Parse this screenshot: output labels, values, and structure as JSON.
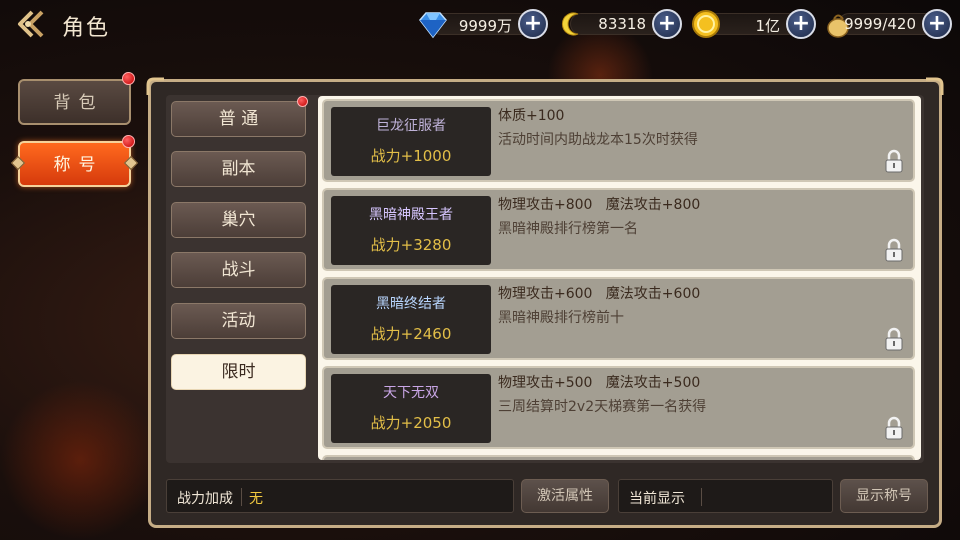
{
  "header": {
    "title": "角色",
    "currencies": [
      {
        "icon": "diamond-gem-icon",
        "value": "9999万"
      },
      {
        "icon": "moon-crescent-icon",
        "value": "83318"
      },
      {
        "icon": "gold-coin-icon",
        "value": "1亿"
      },
      {
        "icon": "stamina-pouch-icon",
        "value": "9999/420"
      }
    ]
  },
  "side_tabs": {
    "bag_label": "背包",
    "title_label": "称号"
  },
  "categories": [
    {
      "label": "普 通"
    },
    {
      "label": "副本"
    },
    {
      "label": "巢穴"
    },
    {
      "label": "战斗"
    },
    {
      "label": "活动"
    },
    {
      "label": "限时"
    }
  ],
  "titles": [
    {
      "name": "巨龙征服者",
      "name_color": "#bfb2d8",
      "power": "战力+1000",
      "attributes": "体质+100",
      "condition": "活动时间内助战龙本15次时获得"
    },
    {
      "name": "黑暗神殿王者",
      "name_color": "#d7c6ff",
      "power": "战力+3280",
      "attributes": "物理攻击+800   魔法攻击+800",
      "condition": "黑暗神殿排行榜第一名"
    },
    {
      "name": "黑暗终结者",
      "name_color": "#b9d7ff",
      "power": "战力+2460",
      "attributes": "物理攻击+600   魔法攻击+600",
      "condition": "黑暗神殿排行榜前十"
    },
    {
      "name": "天下无双",
      "name_color": "#c9a6e6",
      "power": "战力+2050",
      "attributes": "物理攻击+500   魔法攻击+500",
      "condition": "三周结算时2v2天梯赛第一名获得"
    }
  ],
  "bottom": {
    "power_bonus_label": "战力加成",
    "power_bonus_value": "无",
    "activate_button": "激活属性",
    "current_display_label": "当前显示",
    "show_title_button": "显示称号"
  },
  "colors": {
    "accent_orange": "#e8531a",
    "gold_text": "#e3bf48",
    "panel_border": "#c6ad86"
  }
}
